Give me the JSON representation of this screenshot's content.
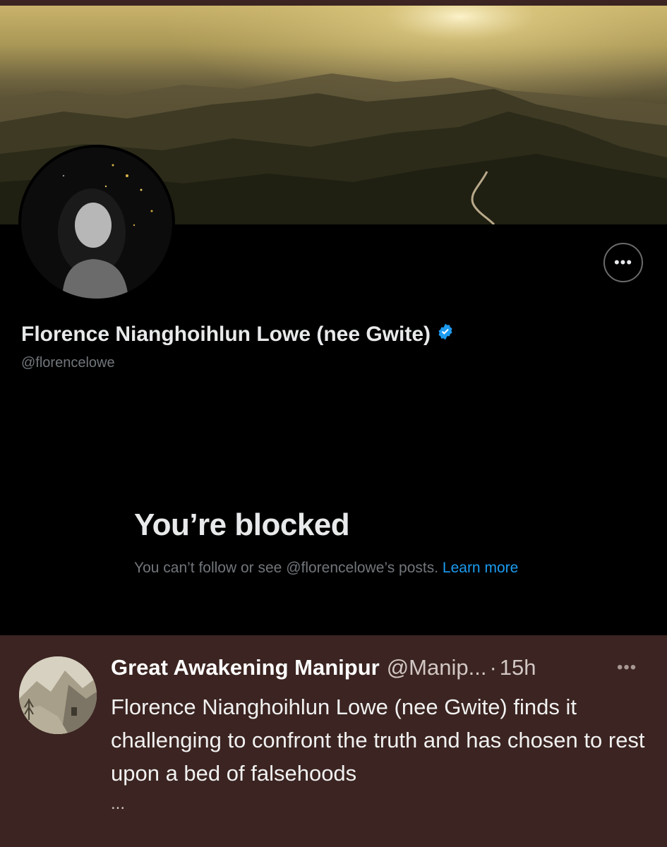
{
  "profile": {
    "display_name": "Florence Nianghoihlun Lowe (nee Gwite)",
    "handle": "@florencelowe",
    "verified_icon": "verified-badge-icon",
    "more_icon": "more-options-icon",
    "more_label": "•••"
  },
  "blocked": {
    "title": "You’re blocked",
    "message": "You can’t follow or see @florencelowe’s posts.",
    "link_text": "Learn more"
  },
  "tweet": {
    "author": "Great Awakening Manipur",
    "handle": "@Manip...",
    "separator": "·",
    "time": "15h",
    "more_label": "•••",
    "text": "Florence Nianghoihlun Lowe (nee Gwite) finds it challenging to confront the truth and has chosen to rest upon a bed of falsehoods",
    "ellipsis": "..."
  },
  "colors": {
    "background": "#000000",
    "tweet_background": "#3b2421",
    "link": "#1d9bf0",
    "verified": "#1d9bf0",
    "secondary_text": "#71767b"
  }
}
